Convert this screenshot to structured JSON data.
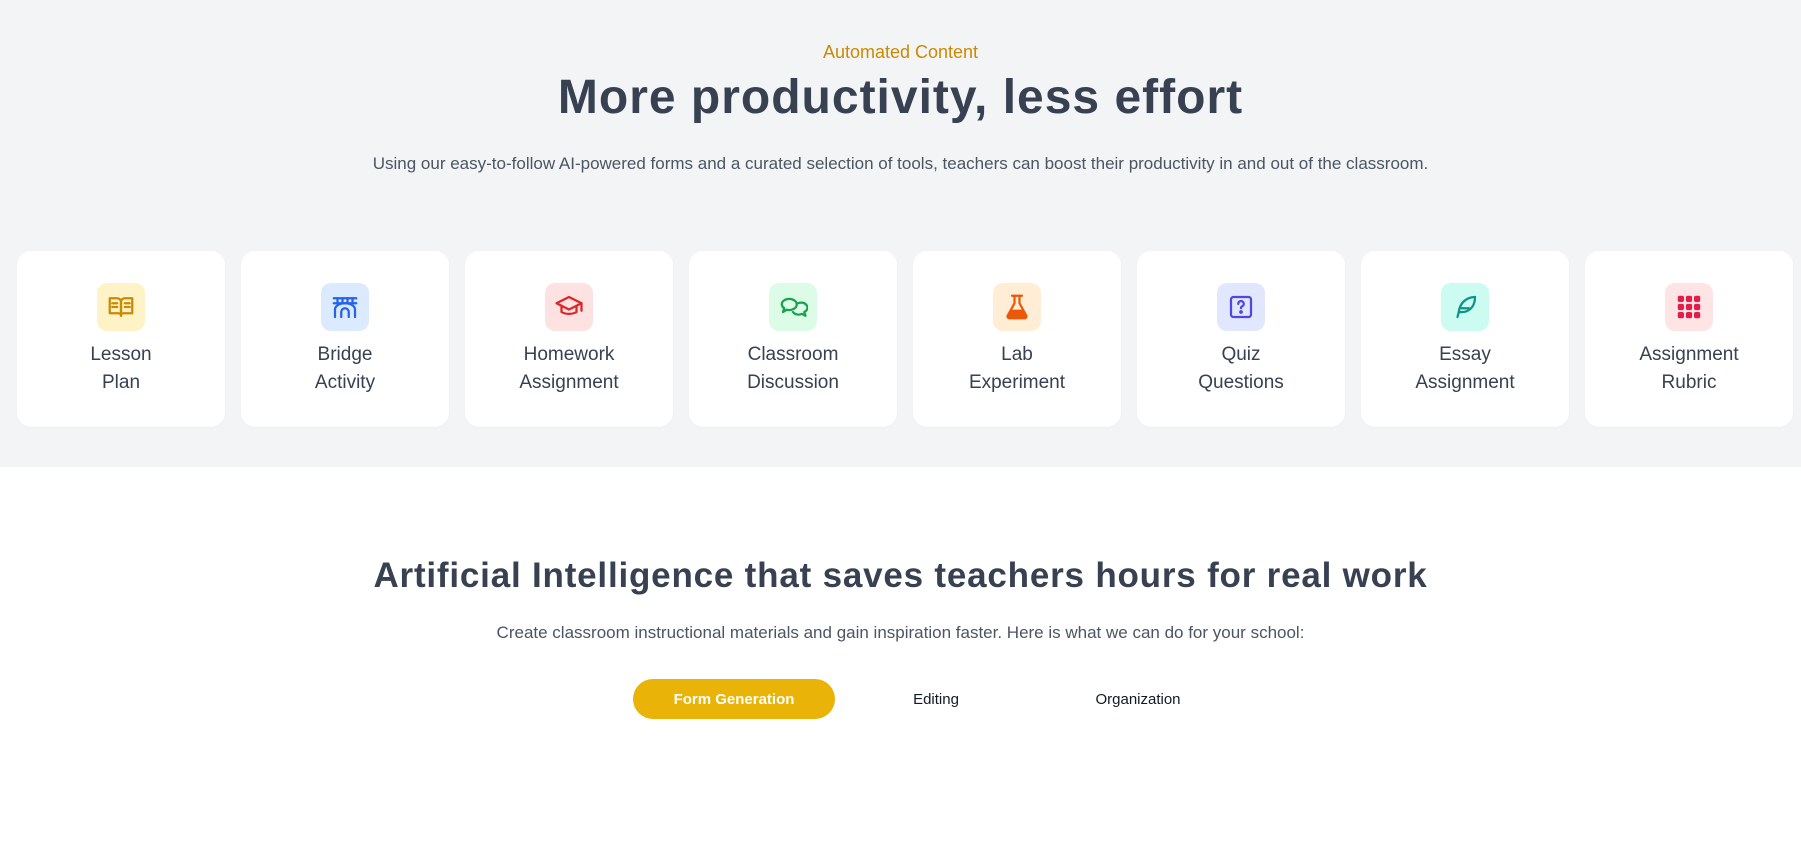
{
  "hero": {
    "eyebrow": "Automated Content",
    "title": "More productivity, less effort",
    "subtitle": "Using our easy-to-follow AI-powered forms and a curated selection of tools, teachers can boost their productivity in and out of the classroom."
  },
  "cards": [
    {
      "line1": "Lesson",
      "line2": "Plan",
      "icon": "book-open-icon",
      "bg": "#fef3c7",
      "fg": "#ca8a04"
    },
    {
      "line1": "Bridge",
      "line2": "Activity",
      "icon": "bridge-icon",
      "bg": "#dbeafe",
      "fg": "#2563eb"
    },
    {
      "line1": "Homework",
      "line2": "Assignment",
      "icon": "graduation-cap-icon",
      "bg": "#fee2e2",
      "fg": "#dc2626"
    },
    {
      "line1": "Classroom",
      "line2": "Discussion",
      "icon": "chat-bubbles-icon",
      "bg": "#dcfce7",
      "fg": "#16a34a"
    },
    {
      "line1": "Lab",
      "line2": "Experiment",
      "icon": "flask-icon",
      "bg": "#ffedd5",
      "fg": "#ea580c"
    },
    {
      "line1": "Quiz",
      "line2": "Questions",
      "icon": "question-box-icon",
      "bg": "#e0e7ff",
      "fg": "#4f46e5"
    },
    {
      "line1": "Essay",
      "line2": "Assignment",
      "icon": "feather-icon",
      "bg": "#ccfbf1",
      "fg": "#0d9488"
    },
    {
      "line1": "Assignment",
      "line2": "Rubric",
      "icon": "grid-dots-icon",
      "bg": "#ffe4e6",
      "fg": "#e11d48"
    }
  ],
  "features": {
    "title": "Artificial Intelligence that saves teachers hours for real work",
    "subtitle": "Create classroom instructional materials and gain inspiration faster. Here is what we can do for your school:",
    "tabs": [
      {
        "label": "Form Generation",
        "active": true
      },
      {
        "label": "Editing",
        "active": false
      },
      {
        "label": "Organization",
        "active": false
      }
    ]
  },
  "colors": {
    "accent": "#eab308",
    "eyebrow": "#ca8a04",
    "sectionBg": "#f3f4f6"
  }
}
